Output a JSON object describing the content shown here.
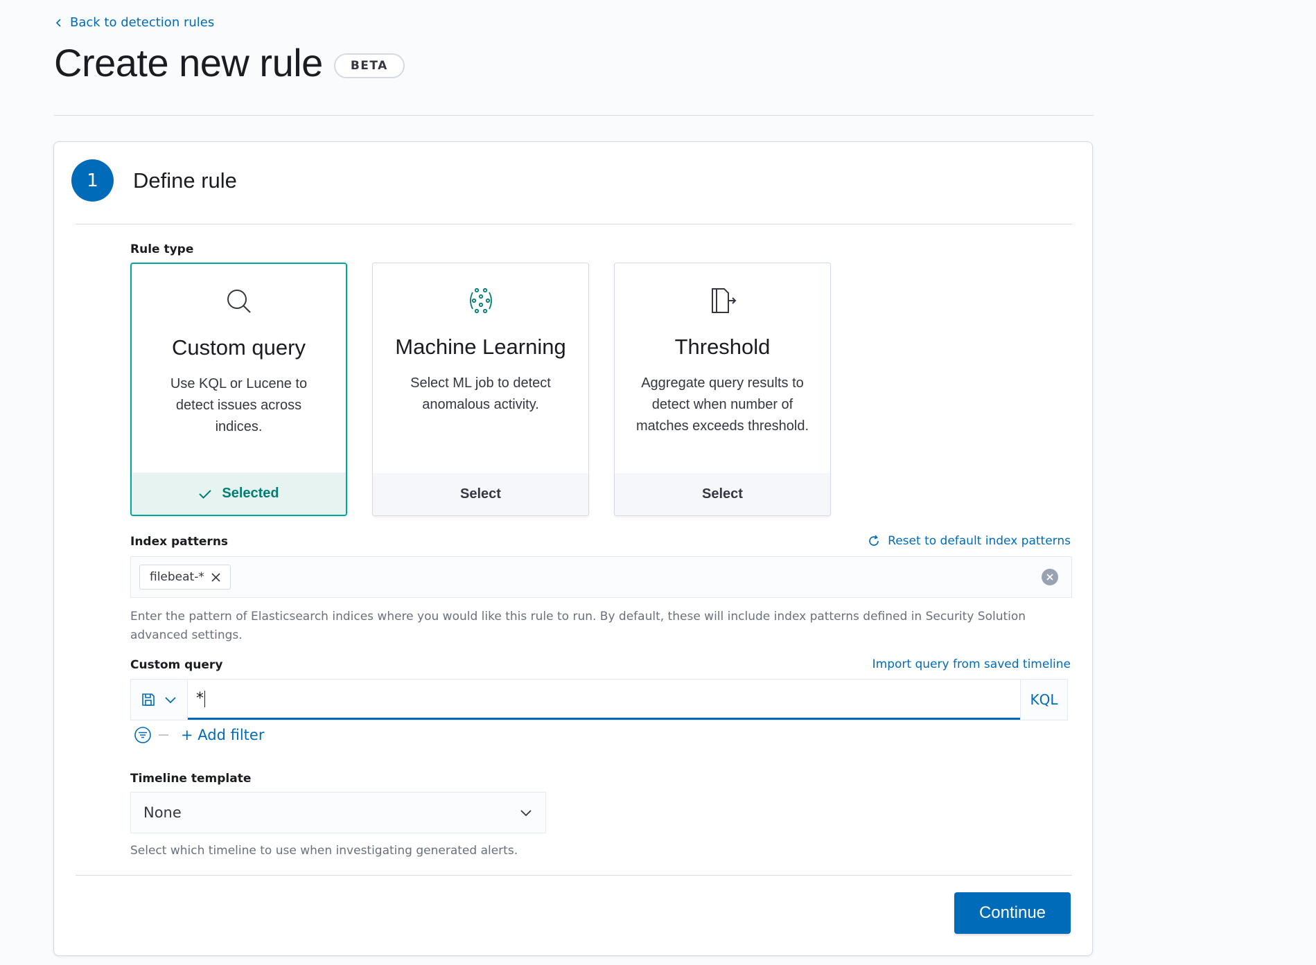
{
  "nav": {
    "back_label": "Back to detection rules"
  },
  "page": {
    "title": "Create new rule",
    "badge": "BETA"
  },
  "step": {
    "number": "1",
    "title": "Define rule"
  },
  "rule_type": {
    "label": "Rule type",
    "cards": [
      {
        "title": "Custom query",
        "description": "Use KQL or Lucene to detect issues across indices.",
        "footer": "Selected",
        "icon": "search-icon",
        "selected": true
      },
      {
        "title": "Machine Learning",
        "description": "Select ML job to detect anomalous activity.",
        "footer": "Select",
        "icon": "machine-learning-icon",
        "selected": false
      },
      {
        "title": "Threshold",
        "description": "Aggregate query results to detect when number of matches exceeds threshold.",
        "footer": "Select",
        "icon": "threshold-icon",
        "selected": false
      }
    ]
  },
  "index_patterns": {
    "label": "Index patterns",
    "reset_label": "Reset to default index patterns",
    "values": [
      "filebeat-*"
    ],
    "help": "Enter the pattern of Elasticsearch indices where you would like this rule to run. By default, these will include index patterns defined in Security Solution advanced settings."
  },
  "custom_query": {
    "label": "Custom query",
    "import_label": "Import query from saved timeline",
    "value": "*",
    "language": "KQL",
    "add_filter_label": "+ Add filter"
  },
  "timeline_template": {
    "label": "Timeline template",
    "value": "None",
    "help": "Select which timeline to use when investigating generated alerts."
  },
  "actions": {
    "continue_label": "Continue"
  },
  "colors": {
    "primary": "#006bb8",
    "success": "#017d73",
    "selected_border": "#00a69b"
  }
}
